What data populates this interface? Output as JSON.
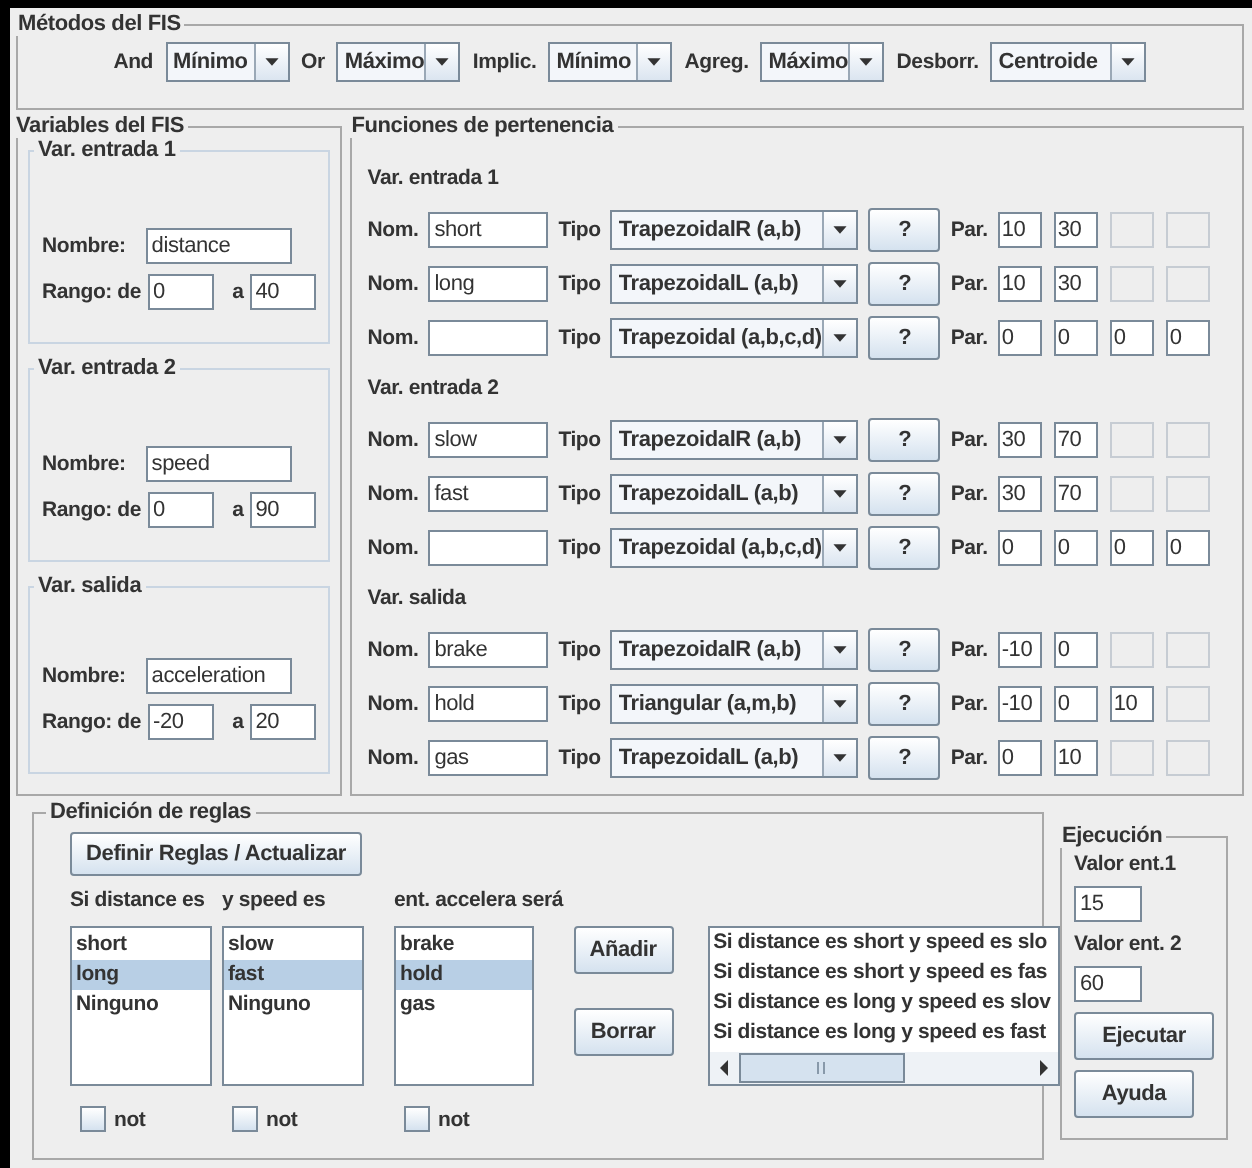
{
  "methods": {
    "title": "Métodos del FIS",
    "items": [
      {
        "label": "And",
        "value": "Mínimo"
      },
      {
        "label": "Or",
        "value": "Máximo"
      },
      {
        "label": "Implic.",
        "value": "Mínimo"
      },
      {
        "label": "Agreg.",
        "value": "Máximo"
      },
      {
        "label": "Desborr.",
        "value": "Centroide"
      }
    ]
  },
  "variables": {
    "title": "Variables del FIS",
    "groups": [
      {
        "title": "Var. entrada 1",
        "name_label": "Nombre:",
        "name": "distance",
        "range_label": "Rango: de",
        "from": "0",
        "to_label": "a",
        "to": "40"
      },
      {
        "title": "Var. entrada 2",
        "name_label": "Nombre:",
        "name": "speed",
        "range_label": "Rango: de",
        "from": "0",
        "to_label": "a",
        "to": "90"
      },
      {
        "title": "Var. salida",
        "name_label": "Nombre:",
        "name": "acceleration",
        "range_label": "Rango: de",
        "from": "-20",
        "to_label": "a",
        "to": "20"
      }
    ]
  },
  "functions": {
    "title": "Funciones de pertenencia",
    "sections": [
      {
        "title": "Var. entrada 1",
        "rows": [
          {
            "nom_label": "Nom.",
            "name": "short",
            "tipo_label": "Tipo",
            "type": "TrapezoidalR (a,b)",
            "help": "?",
            "par_label": "Par.",
            "params": [
              {
                "value": "10",
                "disabled": false
              },
              {
                "value": "30",
                "disabled": false
              },
              {
                "disabled": true
              },
              {
                "disabled": true
              }
            ]
          },
          {
            "nom_label": "Nom.",
            "name": "long",
            "tipo_label": "Tipo",
            "type": "TrapezoidalL (a,b)",
            "help": "?",
            "par_label": "Par.",
            "params": [
              {
                "value": "10",
                "disabled": false
              },
              {
                "value": "30",
                "disabled": false
              },
              {
                "disabled": true
              },
              {
                "disabled": true
              }
            ]
          },
          {
            "nom_label": "Nom.",
            "tipo_label": "Tipo",
            "type": "Trapezoidal (a,b,c,d)",
            "help": "?",
            "par_label": "Par.",
            "params": [
              {
                "value": "0",
                "disabled": false
              },
              {
                "value": "0",
                "disabled": false
              },
              {
                "value": "0",
                "disabled": false
              },
              {
                "value": "0",
                "disabled": false
              }
            ]
          }
        ]
      },
      {
        "title": "Var. entrada 2",
        "rows": [
          {
            "nom_label": "Nom.",
            "name": "slow",
            "tipo_label": "Tipo",
            "type": "TrapezoidalR (a,b)",
            "help": "?",
            "par_label": "Par.",
            "params": [
              {
                "value": "30",
                "disabled": false
              },
              {
                "value": "70",
                "disabled": false
              },
              {
                "disabled": true
              },
              {
                "disabled": true
              }
            ]
          },
          {
            "nom_label": "Nom.",
            "name": "fast",
            "tipo_label": "Tipo",
            "type": "TrapezoidalL (a,b)",
            "help": "?",
            "par_label": "Par.",
            "params": [
              {
                "value": "30",
                "disabled": false
              },
              {
                "value": "70",
                "disabled": false
              },
              {
                "disabled": true
              },
              {
                "disabled": true
              }
            ]
          },
          {
            "nom_label": "Nom.",
            "tipo_label": "Tipo",
            "type": "Trapezoidal (a,b,c,d)",
            "help": "?",
            "par_label": "Par.",
            "params": [
              {
                "value": "0",
                "disabled": false
              },
              {
                "value": "0",
                "disabled": false
              },
              {
                "value": "0",
                "disabled": false
              },
              {
                "value": "0",
                "disabled": false
              }
            ]
          }
        ]
      },
      {
        "title": "Var. salida",
        "rows": [
          {
            "nom_label": "Nom.",
            "name": "brake",
            "tipo_label": "Tipo",
            "type": "TrapezoidalR (a,b)",
            "help": "?",
            "par_label": "Par.",
            "params": [
              {
                "value": "-10",
                "disabled": false
              },
              {
                "value": "0",
                "disabled": false
              },
              {
                "disabled": true
              },
              {
                "disabled": true
              }
            ]
          },
          {
            "nom_label": "Nom.",
            "name": "hold",
            "tipo_label": "Tipo",
            "type": "Triangular (a,m,b)",
            "help": "?",
            "par_label": "Par.",
            "params": [
              {
                "value": "-10",
                "disabled": false
              },
              {
                "value": "0",
                "disabled": false
              },
              {
                "value": "10",
                "disabled": false
              },
              {
                "disabled": true
              }
            ]
          },
          {
            "nom_label": "Nom.",
            "name": "gas",
            "tipo_label": "Tipo",
            "type": "TrapezoidalL (a,b)",
            "help": "?",
            "par_label": "Par.",
            "params": [
              {
                "value": "0",
                "disabled": false
              },
              {
                "value": "10",
                "disabled": false
              },
              {
                "disabled": true
              },
              {
                "disabled": true
              }
            ]
          }
        ]
      }
    ]
  },
  "rules": {
    "title": "Definición de reglas",
    "define_button": "Definir Reglas / Actualizar",
    "lists": [
      {
        "heading": "Si distance es",
        "items": [
          {
            "text": "short",
            "selected": false
          },
          {
            "text": "long",
            "selected": true
          },
          {
            "text": "Ninguno",
            "selected": false
          }
        ],
        "not": {
          "label": "not",
          "checked": false
        }
      },
      {
        "heading": "y speed es",
        "items": [
          {
            "text": "slow",
            "selected": false
          },
          {
            "text": "fast",
            "selected": true
          },
          {
            "text": "Ninguno",
            "selected": false
          }
        ],
        "not": {
          "label": "not",
          "checked": false
        }
      },
      {
        "heading": "ent. accelera será",
        "items": [
          {
            "text": "brake",
            "selected": false
          },
          {
            "text": "hold",
            "selected": true
          },
          {
            "text": "gas",
            "selected": false
          }
        ],
        "not": {
          "label": "not",
          "checked": false
        }
      }
    ],
    "add_button": "Añadir",
    "delete_button": "Borrar",
    "rule_lines": [
      "Si distance es short y speed es slo",
      "Si distance es short y speed es fas",
      "Si distance es long y speed es slov",
      "Si distance es long y speed es fast"
    ]
  },
  "execution": {
    "title": "Ejecución",
    "inputs": [
      {
        "label": "Valor ent.1",
        "value": "15"
      },
      {
        "label": "Valor ent. 2",
        "value": "60"
      }
    ],
    "buttons": [
      "Ejecutar",
      "Ayuda"
    ]
  }
}
